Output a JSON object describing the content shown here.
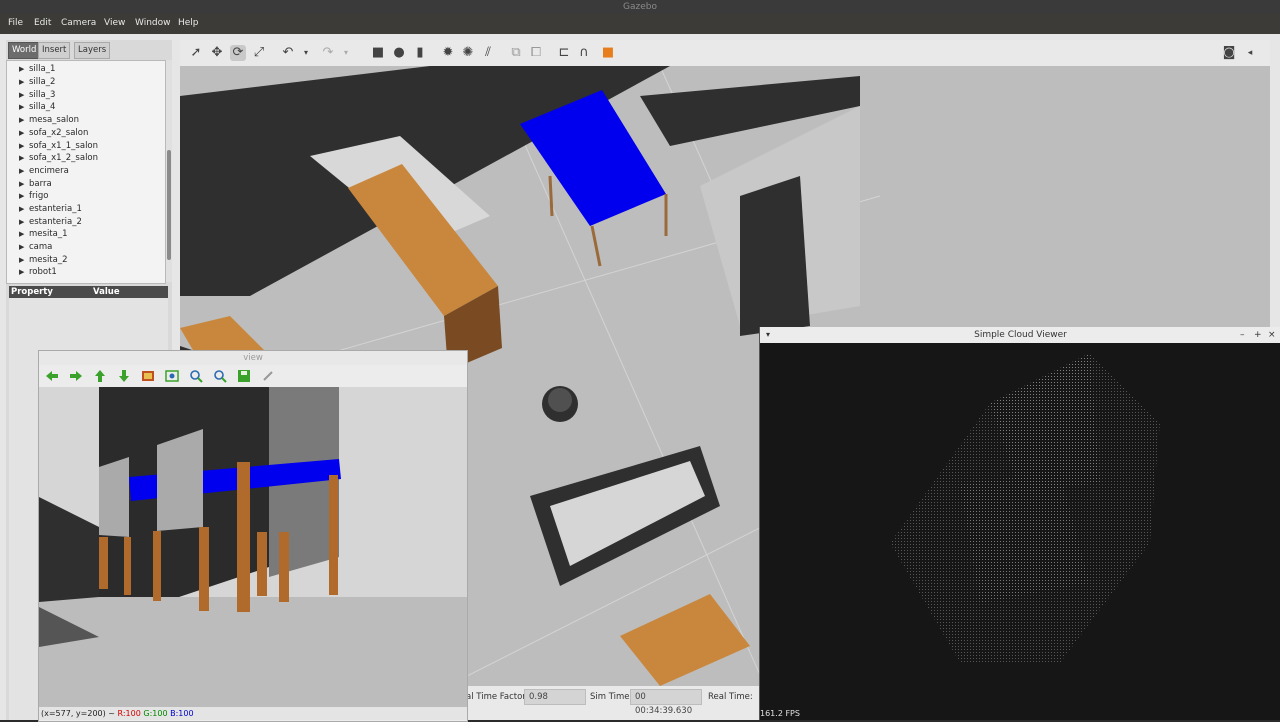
{
  "window": {
    "title": "Gazebo"
  },
  "menu": {
    "file": "File",
    "edit": "Edit",
    "camera": "Camera",
    "view": "View",
    "window": "Window",
    "help": "Help"
  },
  "left_panel": {
    "tabs": [
      "World",
      "Insert",
      "Layers"
    ],
    "tree_items": [
      "silla_1",
      "silla_2",
      "silla_3",
      "silla_4",
      "mesa_salon",
      "sofa_x2_salon",
      "sofa_x1_1_salon",
      "sofa_x1_2_salon",
      "encimera",
      "barra",
      "frigo",
      "estanteria_1",
      "estanteria_2",
      "mesita_1",
      "cama",
      "mesita_2",
      "robot1"
    ],
    "properties": {
      "col_property": "Property",
      "col_value": "Value"
    }
  },
  "toolbar_icons": [
    "select-arrow-icon",
    "translate-icon",
    "rotate-icon",
    "scale-icon",
    "undo-icon",
    "redo-icon",
    "box-icon",
    "sphere-icon",
    "cylinder-icon",
    "point-light-icon",
    "spot-light-icon",
    "directional-light-icon",
    "copy-icon",
    "paste-icon",
    "align-icon",
    "snap-icon",
    "color-icon",
    "screenshot-icon"
  ],
  "status": {
    "real_time_factor_label": "al Time Factor:",
    "real_time_factor_value": "0.98",
    "sim_time_label": "Sim Time:",
    "sim_time_value": "00 00:34:39.630",
    "real_time_label": "Real Time:"
  },
  "view_window": {
    "title": "view",
    "status_coords": "(x=577, y=200) ~",
    "status_r": "R:100",
    "status_g": "G:100",
    "status_b": "B:100"
  },
  "cloud_window": {
    "title": "Simple Cloud Viewer",
    "fps": "161.2 FPS"
  },
  "colors": {
    "accent_blue": "#0000ee",
    "wood": "#c9873e",
    "floor": "#bdbdbd",
    "wall": "#2f2f2f"
  }
}
